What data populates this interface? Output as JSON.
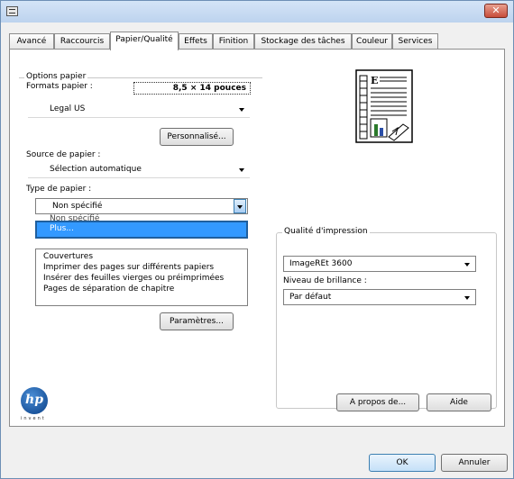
{
  "tabs": [
    "Avancé",
    "Raccourcis",
    "Papier/Qualité",
    "Effets",
    "Finition",
    "Stockage des tâches",
    "Couleur",
    "Services"
  ],
  "active_tab": "Papier/Qualité",
  "paper_options": {
    "group_label": "Options papier",
    "formats_label": "Formats papier :",
    "size_value": "8,5 × 14 pouces",
    "format_select": "Legal US",
    "custom_button": "Personnalisé...",
    "source_label": "Source de papier :",
    "source_select": "Sélection automatique",
    "type_label": "Type de papier :",
    "type_select": "Non spécifié",
    "dropdown_items": [
      "Non spécifié",
      "Plus..."
    ],
    "covers_items": [
      "Couvertures",
      "Imprimer des pages sur différents papiers",
      "Insérer des feuilles vierges ou préimprimées",
      "Pages de séparation de chapitre"
    ],
    "params_button": "Paramètres..."
  },
  "print_quality": {
    "group_label": "Qualité d'impression",
    "quality_select": "ImageREt 3600",
    "gloss_label": "Niveau de brillance :",
    "gloss_select": "Par défaut"
  },
  "branding": {
    "logo_text": "hp",
    "invent": "invent"
  },
  "buttons": {
    "about": "A propos de...",
    "help": "Aide",
    "ok": "OK",
    "cancel": "Annuler"
  },
  "colors": {
    "highlight": "#3399ff",
    "titlebar": "#bdd3ee",
    "close": "#c74c3a"
  }
}
